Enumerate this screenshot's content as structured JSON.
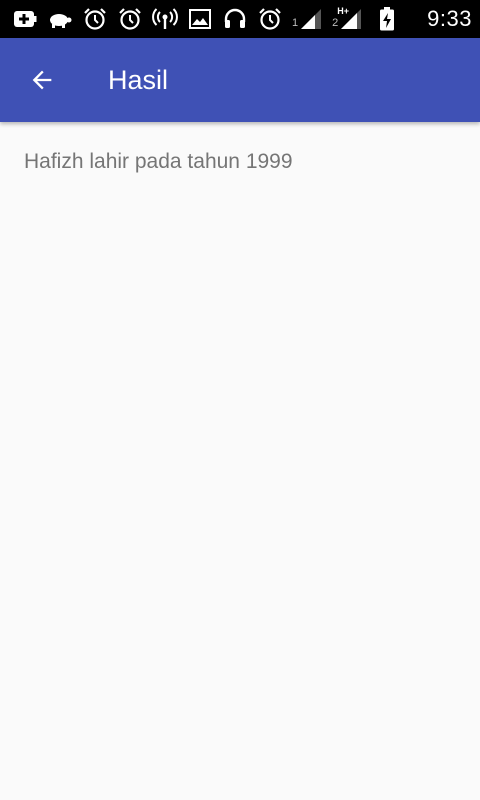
{
  "status_bar": {
    "icons": [
      "battery-plus-icon",
      "tortoise-icon",
      "alarm-clock-icon",
      "alarm-clock-icon",
      "wifi-hotspot-icon",
      "image-icon",
      "headphones-icon",
      "alarm-clock-icon"
    ],
    "sim1_label": "1",
    "sim2_label": "2",
    "network_type": "H+",
    "time": "9:33"
  },
  "app_bar": {
    "title": "Hasil",
    "background_color": "#3f51b5",
    "back_icon": "arrow-back-icon"
  },
  "content": {
    "result_text": "Hafizh lahir pada tahun 1999"
  }
}
